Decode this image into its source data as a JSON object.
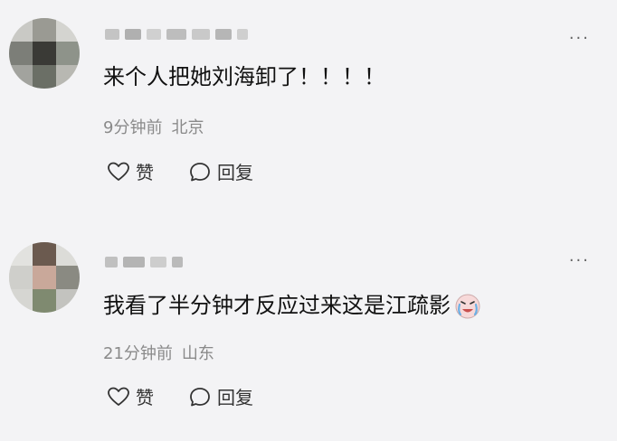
{
  "comments": [
    {
      "text": "来个人把她刘海卸了！！！！",
      "time": "9分钟前",
      "location": "北京",
      "like_label": "赞",
      "reply_label": "回复"
    },
    {
      "text": "我看了半分钟才反应过来这是江疏影",
      "time": "21分钟前",
      "location": "山东",
      "like_label": "赞",
      "reply_label": "回复",
      "emoji": "crying-laughing-emoji"
    }
  ],
  "more_label": "···",
  "icons": {
    "like": "heart-icon",
    "reply": "comment-bubble-icon",
    "more": "more-dots-icon"
  }
}
